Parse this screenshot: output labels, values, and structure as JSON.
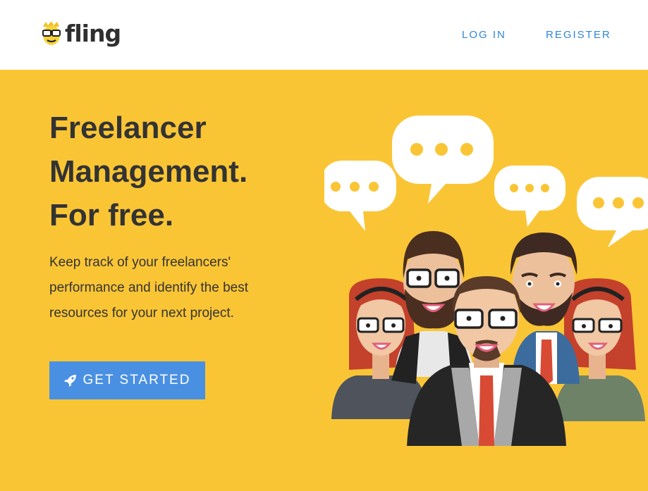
{
  "header": {
    "logo_text": "fling",
    "logo_icon": "glasses-mascot-icon",
    "nav": {
      "login_label": "LOG IN",
      "register_label": "REGISTER"
    }
  },
  "hero": {
    "headline": [
      "Freelancer",
      "Management.",
      "For free."
    ],
    "subtext": [
      "Keep track of your freelancers'",
      "performance and identify the best",
      "resources for your next project."
    ],
    "cta_label": "GET STARTED",
    "cta_icon": "rocket-icon",
    "illustration": "team-with-speech-bubbles-illustration"
  },
  "colors": {
    "background": "#FAC535",
    "header_bg": "#FFFFFF",
    "link": "#2F86D6",
    "button": "#4A90E2",
    "text": "#333333"
  }
}
